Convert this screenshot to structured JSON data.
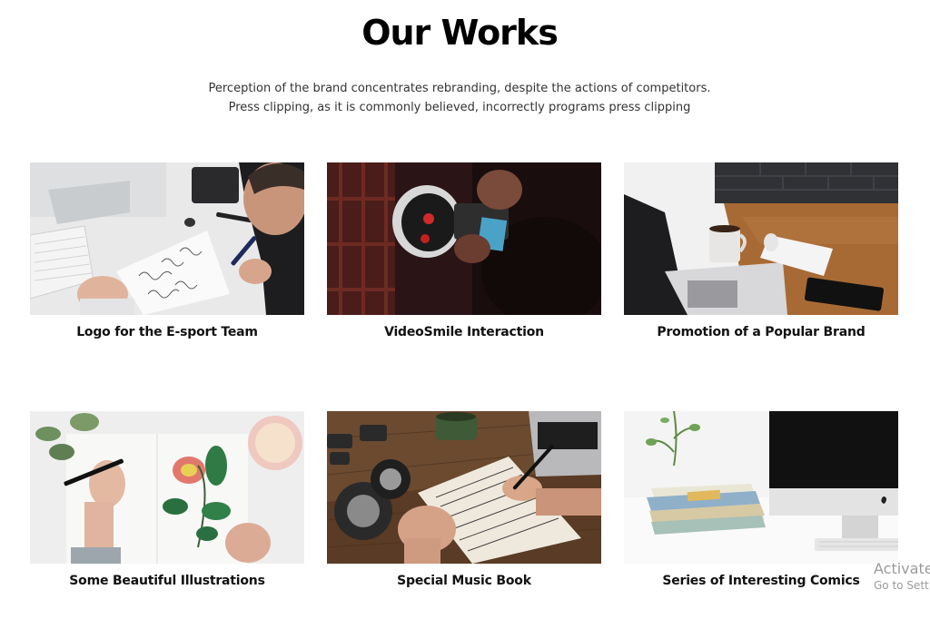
{
  "section": {
    "title": "Our Works",
    "subtitle_line1": "Perception of the brand concentrates rebranding, despite the actions of competitors.",
    "subtitle_line2": "Press clipping, as it is commonly believed, incorrectly programs press clipping"
  },
  "works": [
    {
      "title": "Logo for the E-sport Team",
      "image": "calligraphy-writing-photo"
    },
    {
      "title": "VideoSmile Interaction",
      "image": "camera-operator-photo"
    },
    {
      "title": "Promotion of a Popular Brand",
      "image": "laptop-desk-photo"
    },
    {
      "title": "Some Beautiful Illustrations",
      "image": "flower-drawing-photo"
    },
    {
      "title": "Special Music Book",
      "image": "music-sheet-writing-photo"
    },
    {
      "title": "Series of Interesting Comics",
      "image": "imac-books-photo"
    }
  ],
  "watermark": {
    "line1": "Activate",
    "line2": "Go to Sett"
  }
}
